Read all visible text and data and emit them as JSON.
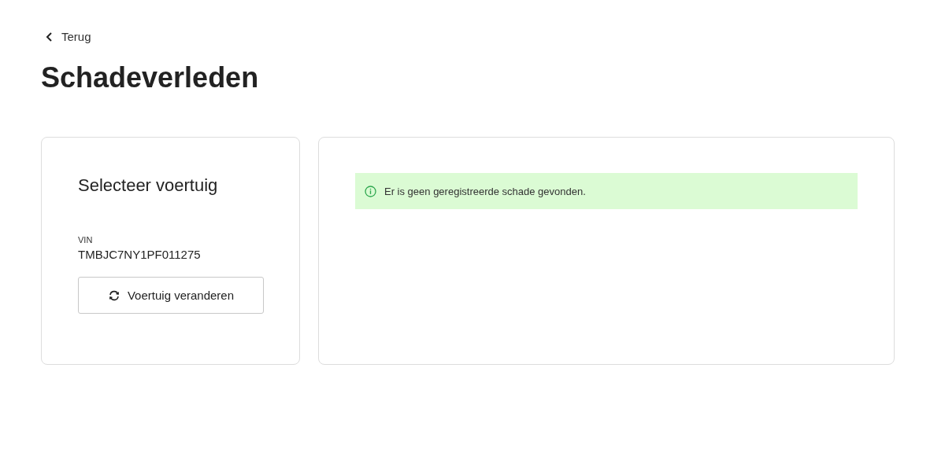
{
  "back_link": {
    "label": "Terug"
  },
  "title": "Schadeverleden",
  "vehicle_card": {
    "heading": "Selecteer voertuig",
    "field_label": "VIN",
    "field_value": "TMBJC7NY1PF011275",
    "button": "Voertuig veranderen"
  },
  "result_card": {
    "alert": {
      "kind": "success",
      "message": "Er is geen geregistreerde schade gevonden."
    }
  }
}
